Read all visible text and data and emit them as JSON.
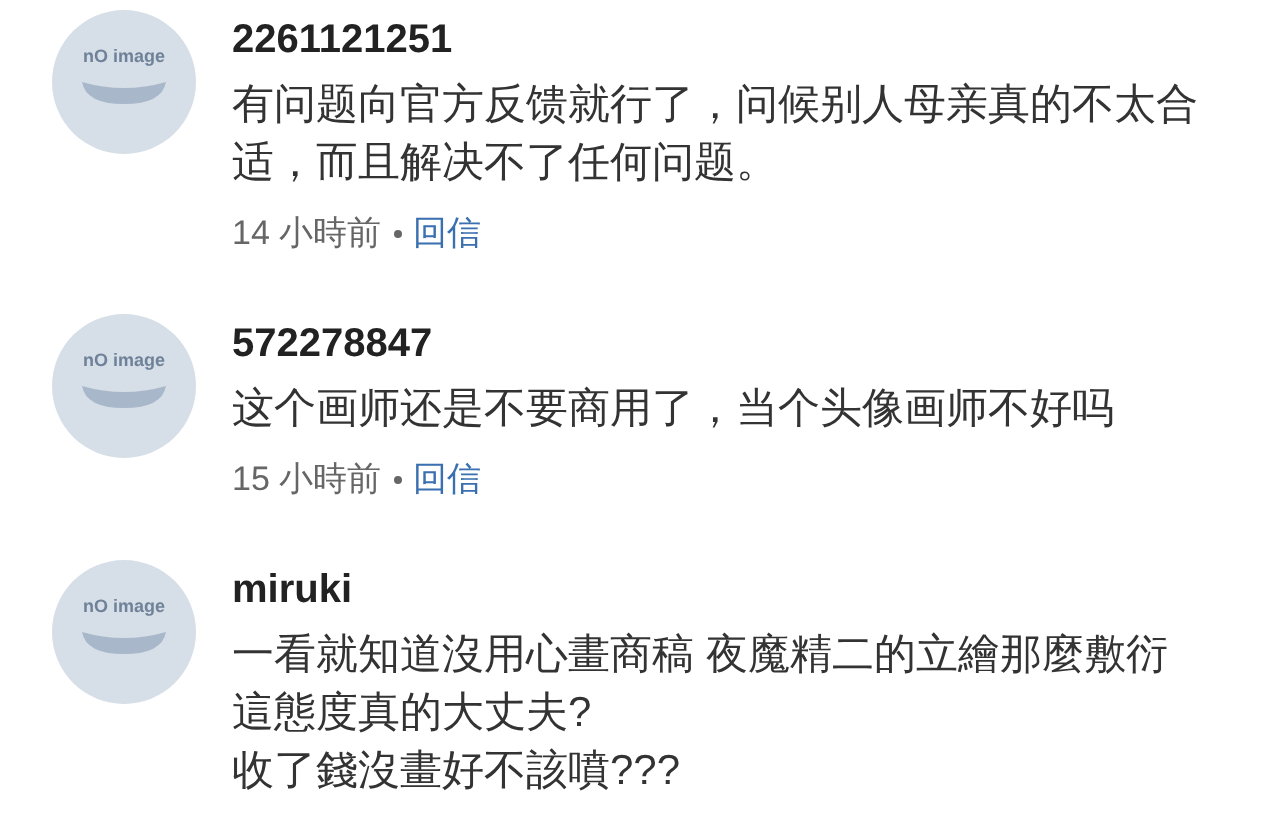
{
  "comments": [
    {
      "avatar_text": "nO image",
      "username": "2261121251",
      "lines": [
        "有问题向官方反馈就行了，问候别人母亲真的不太合适，而且解决不了任何问题。"
      ],
      "time": "14 小時前",
      "reply": "回信"
    },
    {
      "avatar_text": "nO image",
      "username": "572278847",
      "lines": [
        "这个画师还是不要商用了，当个头像画师不好吗"
      ],
      "time": "15 小時前",
      "reply": "回信"
    },
    {
      "avatar_text": "nO image",
      "username": "miruki",
      "lines": [
        "一看就知道沒用心畫商稿 夜魔精二的立繪那麼敷衍",
        "這態度真的大丈夫?",
        "收了錢沒畫好不該噴???"
      ]
    }
  ]
}
